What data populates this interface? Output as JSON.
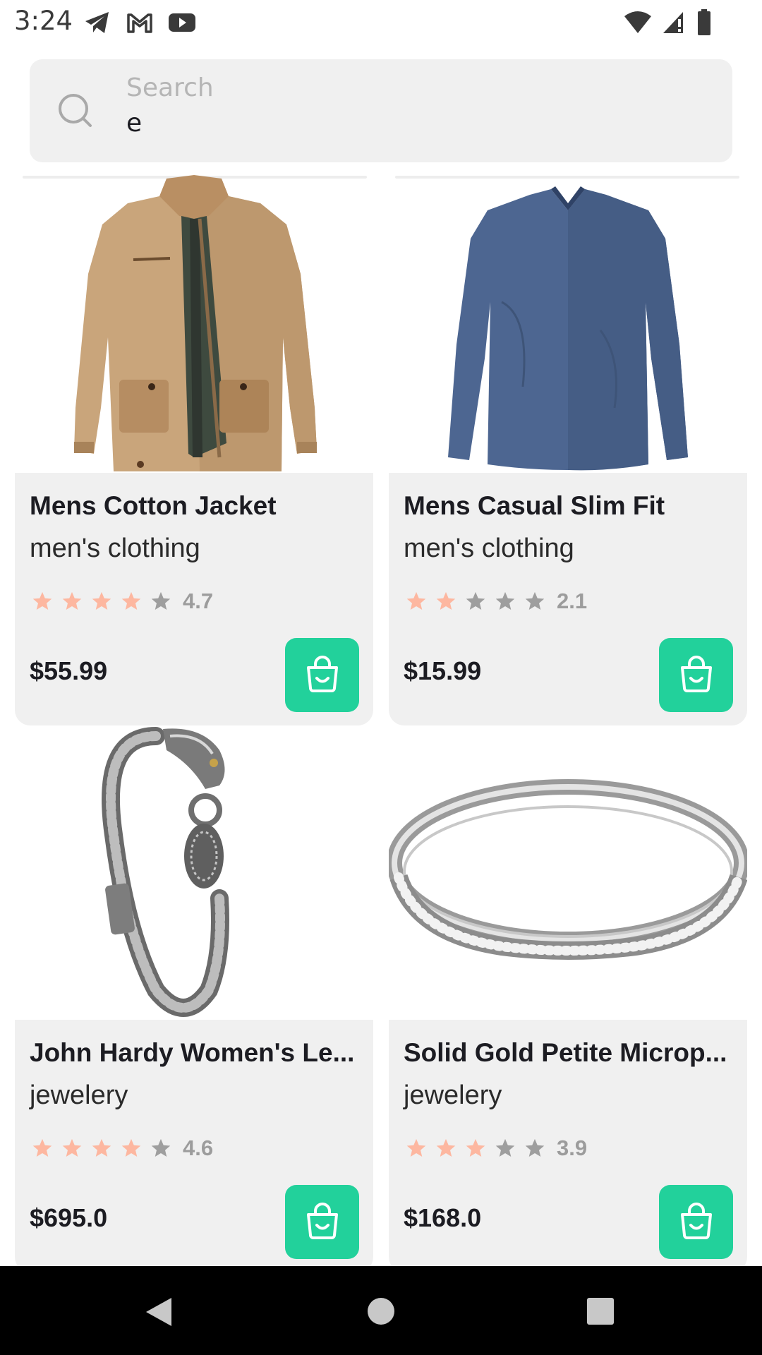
{
  "status_bar": {
    "time": "3:24",
    "icons_left": [
      "telegram-icon",
      "gmail-icon",
      "youtube-icon"
    ],
    "icons_right": [
      "wifi-icon",
      "signal-icon",
      "battery-icon"
    ]
  },
  "search": {
    "label": "Search",
    "value": "e",
    "icon": "search-icon"
  },
  "colors": {
    "accent": "#22d19b",
    "star_filled": "#fdb7a0",
    "star_empty": "#9e9e9e",
    "card_background": "#f0f0f0"
  },
  "products": [
    {
      "title": "Mens Cotton Jacket",
      "category": "men's clothing",
      "rating": 4.7,
      "rating_text": "4.7",
      "stars_filled": 4,
      "price": "$55.99",
      "image": "jacket-image"
    },
    {
      "title": "Mens Casual Slim Fit",
      "category": "men's clothing",
      "rating": 2.1,
      "rating_text": "2.1",
      "stars_filled": 2,
      "price": "$15.99",
      "image": "shirt-image"
    },
    {
      "title": "John Hardy Women's Le...",
      "category": "jewelery",
      "rating": 4.6,
      "rating_text": "4.6",
      "stars_filled": 4,
      "price": "$695.0",
      "image": "bracelet-image"
    },
    {
      "title": "Solid Gold Petite Microp...",
      "category": "jewelery",
      "rating": 3.9,
      "rating_text": "3.9",
      "stars_filled": 3,
      "price": "$168.0",
      "image": "ring-image"
    }
  ],
  "nav_bar": {
    "buttons": [
      "back-icon",
      "home-icon",
      "recents-icon"
    ]
  }
}
